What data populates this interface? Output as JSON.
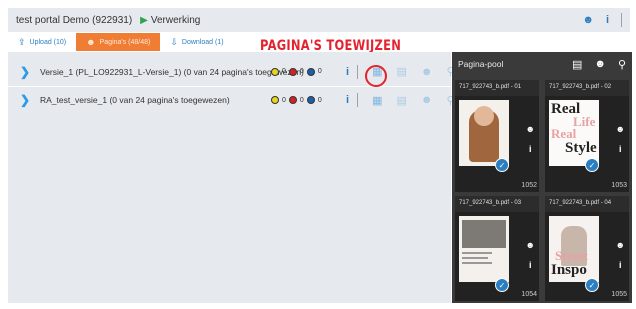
{
  "header": {
    "title": "test portal Demo (922931)",
    "step_label": "Verwerking",
    "user_icon": "user-icon",
    "info_icon": "info-icon"
  },
  "tabs": [
    {
      "label": "Upload (10)",
      "icon": "upload-icon",
      "active": false
    },
    {
      "label": "Pagina's (48/48)",
      "icon": "pages-icon",
      "active": true
    },
    {
      "label": "Download (1)",
      "icon": "download-icon",
      "active": false
    }
  ],
  "annotation": "PAGINA'S TOEWIJZEN",
  "versions": [
    {
      "label": "Versie_1 (PL_LO922931_L-Versie_1) (0 van 24 pagina's toegewezen)",
      "counts": [
        0,
        0,
        0
      ]
    },
    {
      "label": "RA_test_versie_1 (0 van 24 pagina's toegewezen)",
      "counts": [
        0,
        0,
        0
      ]
    }
  ],
  "status_colors": [
    "#e6d41e",
    "#d32222",
    "#1b5fa8"
  ],
  "pool": {
    "title": "Pagina-pool",
    "cards": [
      {
        "caption": "717_922743_b.pdf - 01",
        "number": "1052",
        "preview_text": ""
      },
      {
        "caption": "717_922743_b.pdf - 02",
        "number": "1053",
        "preview_text": "Real Life Real Style"
      },
      {
        "caption": "717_922743_b.pdf - 03",
        "number": "1054",
        "preview_text": ""
      },
      {
        "caption": "717_922743_b.pdf - 04",
        "number": "1055",
        "preview_text": "Street Inspo"
      }
    ]
  }
}
